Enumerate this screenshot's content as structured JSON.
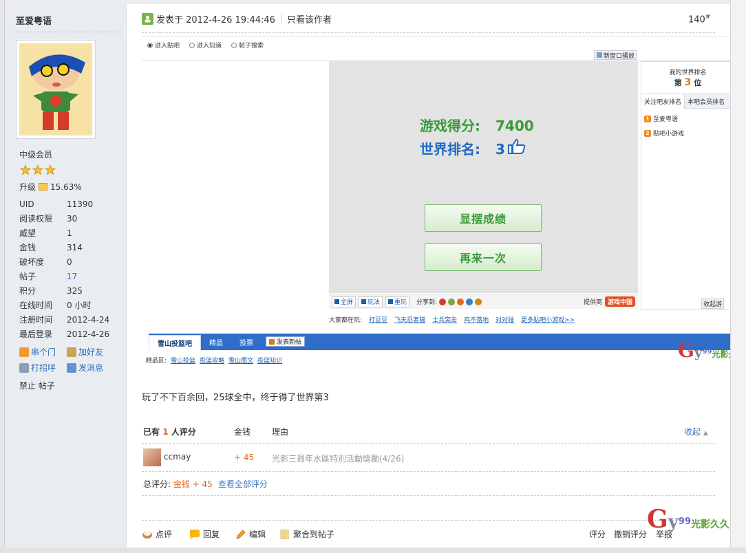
{
  "sidebar": {
    "username": "至爱粤语",
    "group": "中级会员",
    "upgrade_label": "升级",
    "upgrade_percent": "15.63%",
    "stars": 3,
    "stats": [
      {
        "label": "UID",
        "value": "11390"
      },
      {
        "label": "阅读权限",
        "value": "30"
      },
      {
        "label": "威望",
        "value": "1"
      },
      {
        "label": "金钱",
        "value": "314"
      },
      {
        "label": "破坏度",
        "value": "0"
      },
      {
        "label": "帖子",
        "value": "17"
      },
      {
        "label": "积分",
        "value": "325"
      },
      {
        "label": "在线时间",
        "value": "0 小时"
      },
      {
        "label": "注册时间",
        "value": "2012-4-24"
      },
      {
        "label": "最后登录",
        "value": "2012-4-26"
      }
    ],
    "actions": {
      "visit": "串个门",
      "add_friend": "加好友",
      "greet": "打招呼",
      "message": "发消息"
    },
    "ban": "禁止",
    "posts": "帖子"
  },
  "post": {
    "posted_at": "发表于 2012-4-26 19:44:46",
    "only_author": "只看该作者",
    "floor": "140",
    "floor_mark": "#",
    "text": "玩了不下百余回，25球全中，终于得了世界第3"
  },
  "shot": {
    "radios": [
      "进入贴吧",
      "进入知道",
      "帖子搜索"
    ],
    "popup": "新窗口播放",
    "score_label": "游戏得分:",
    "score_value": "7400",
    "rank_label": "世界排名:",
    "rank_value": "3",
    "btn_show": "显摆成绩",
    "btn_again": "再来一次",
    "toolbar": {
      "fullscreen": "全屏",
      "howto": "玩法",
      "replay": "重玩",
      "share": "分享到:",
      "provider": "提供商",
      "provider_logo": "游戏中国"
    },
    "players_label": "大家都在玩:",
    "players": [
      "打豆豆",
      "飞天忍者猫",
      "士兵突击",
      "鸡不落地",
      "对对碰",
      "更多贴吧小游戏>>"
    ],
    "rank_panel": {
      "title": "我的世界排名",
      "pre": "第",
      "num": "3",
      "post": "位",
      "tab1": "关注吧友排名",
      "tab2": "本吧会员排名",
      "item1": "至爱粤语",
      "item2": "贴吧小游戏",
      "collect": "收起游"
    },
    "forum_tabs": [
      "雪山投篮吧",
      "精品",
      "投票"
    ],
    "new_post": "发表新帖",
    "subnav_label": "精品区:",
    "subnav": [
      "雪山投篮",
      "投篮攻略",
      "雪山图文",
      "投篮知识"
    ]
  },
  "rating": {
    "prefix": "已有",
    "count": "1",
    "suffix": "人评分",
    "col_money": "金钱",
    "col_reason": "理由",
    "collapse": "收起",
    "entries": [
      {
        "user": "ccmay",
        "amount": "+ 45",
        "reason": "光影三週年水區特別活動獎勵(4/26)"
      }
    ],
    "total_label": "总评分:",
    "total_value": "金钱 + 45",
    "view_all": "查看全部评分"
  },
  "bottom": {
    "comment": "点评",
    "reply": "回复",
    "edit": "编辑",
    "aggregate": "聚合到帖子",
    "rate": "评分",
    "undo_rate": "撤销评分",
    "report": "举报"
  },
  "watermark": {
    "g": "G",
    "y": "y",
    "n": "99",
    "text": "光影久久"
  }
}
